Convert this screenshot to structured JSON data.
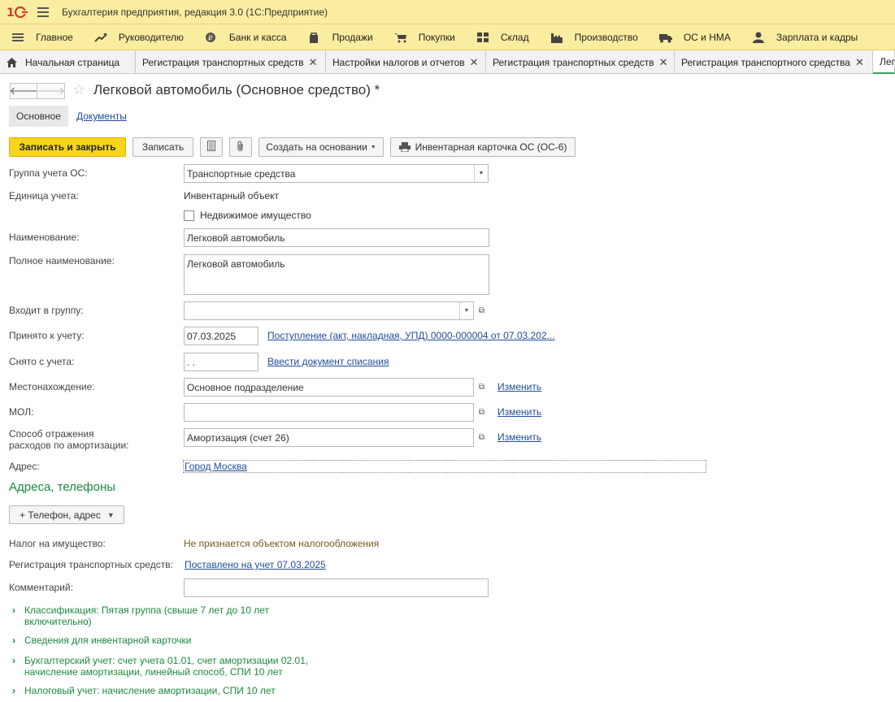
{
  "app": {
    "logo_text": "1С",
    "title": "Бухгалтерия предприятия, редакция 3.0  (1С:Предприятие)"
  },
  "sections": [
    {
      "label": "Главное",
      "icon": "menu-lines-icon"
    },
    {
      "label": "Руководителю",
      "icon": "trend-chart-icon"
    },
    {
      "label": "Банк и касса",
      "icon": "coin-icon"
    },
    {
      "label": "Продажи",
      "icon": "shopping-bag-icon"
    },
    {
      "label": "Покупки",
      "icon": "cart-icon"
    },
    {
      "label": "Склад",
      "icon": "warehouse-grid-icon"
    },
    {
      "label": "Производство",
      "icon": "factory-icon"
    },
    {
      "label": "ОС и НМА",
      "icon": "truck-icon"
    },
    {
      "label": "Зарплата и кадры",
      "icon": "person-icon"
    }
  ],
  "tabs": [
    {
      "label": "Начальная страница",
      "icon": "home-icon"
    },
    {
      "label": "Регистрация транспортных средств"
    },
    {
      "label": "Настройки налогов и отчетов"
    },
    {
      "label": "Регистрация транспортных средств"
    },
    {
      "label": "Регистрация транспортного средства"
    },
    {
      "label": "Лег"
    }
  ],
  "form": {
    "title": "Легковой автомобиль (Основное средство) *",
    "tab_main": "Основное",
    "tab_docs": "Документы",
    "btn_save_close": "Записать и закрыть",
    "btn_save": "Записать",
    "btn_create_based": "Создать на основании",
    "btn_inventory_card": "Инвентарная карточка ОС (ОС-6)"
  },
  "fields": {
    "group_label": "Группа учета ОС:",
    "group_value": "Транспортные средства",
    "unit_label": "Единица учета:",
    "unit_value": "Инвентарный объект",
    "realty_label": "Недвижимое имущество",
    "name_label": "Наименование:",
    "name_value": "Легковой автомобиль",
    "fullname_label": "Полное наименование:",
    "fullname_value": "Легковой автомобиль",
    "parent_label": "Входит в группу:",
    "parent_value": "",
    "accepted_label": "Принято к учету:",
    "accepted_date": "07.03.2025",
    "accepted_link": "Поступление (акт, накладная, УПД) 0000-000004 от 07.03.202...",
    "removed_label": "Снято с учета:",
    "removed_date": " .  .",
    "removed_link": "Ввести документ списания",
    "location_label": "Местонахождение:",
    "location_value": "Основное подразделение",
    "location_change": "Изменить",
    "mol_label": "МОЛ:",
    "mol_value": "",
    "mol_change": "Изменить",
    "amort_label_1": "Способ отражения",
    "amort_label_2": "расходов по амортизации:",
    "amort_value": "Амортизация (счет 26)",
    "amort_change": "Изменить",
    "address_label": "Адрес:",
    "address_value": "Город Москва",
    "contacts_group": "Адреса, телефоны",
    "phone_btn": "+ Телефон, адрес",
    "tax_label": "Налог на имущество:",
    "tax_value": "Не признается объектом налогообложения",
    "transport_label": "Регистрация транспортных средств:",
    "transport_link": "Поставлено на учет 07.03.2025",
    "comment_label": "Комментарий:",
    "comment_value": ""
  },
  "sections_collapsed": [
    {
      "line1": "Классификация: Пятая группа (свыше 7 лет до 10 лет",
      "line2": "включительно)"
    },
    {
      "line1": "Сведения для инвентарной карточки",
      "line2": ""
    },
    {
      "line1": "Бухгалтерский учет: счет учета 01.01, счет амортизации 02.01,",
      "line2": "начисление амортизации, линейный способ, СПИ 10 лет"
    },
    {
      "line1": "Налоговый учет: начисление амортизации, СПИ 10 лет",
      "line2": ""
    }
  ]
}
